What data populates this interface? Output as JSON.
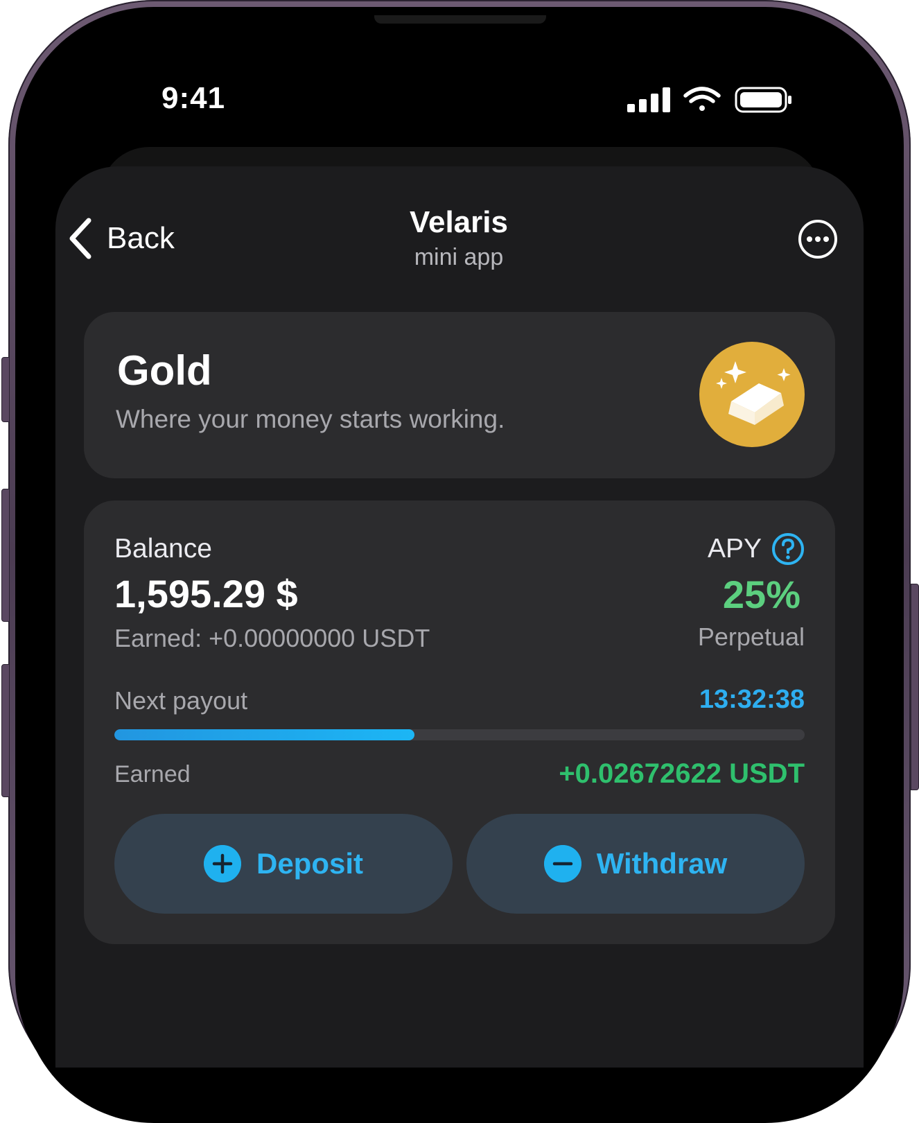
{
  "status_bar": {
    "time": "9:41"
  },
  "nav": {
    "back_label": "Back",
    "title": "Velaris",
    "subtitle": "mini app",
    "more_icon": "more-dots-icon"
  },
  "plan_card": {
    "title": "Gold",
    "subtitle": "Where your money starts working.",
    "badge_icon": "gold-bar-icon",
    "badge_color": "#e1ae3c"
  },
  "balance_card": {
    "balance_label": "Balance",
    "balance_value": "1,595.29 $",
    "earned_total": "Earned: +0.00000000 USDT",
    "apy_label": "APY",
    "apy_value": "25%",
    "apy_term": "Perpetual",
    "next_payout_label": "Next payout",
    "next_payout_timer": "13:32:38",
    "payout_progress_percent": 43.5,
    "earned_label": "Earned",
    "earned_value": "+0.02672622 USDT",
    "deposit_label": "Deposit",
    "withdraw_label": "Withdraw"
  },
  "colors": {
    "accent_blue": "#2eb4f2",
    "apy_green": "#5ccf7f",
    "earned_green": "#2fc06d"
  }
}
